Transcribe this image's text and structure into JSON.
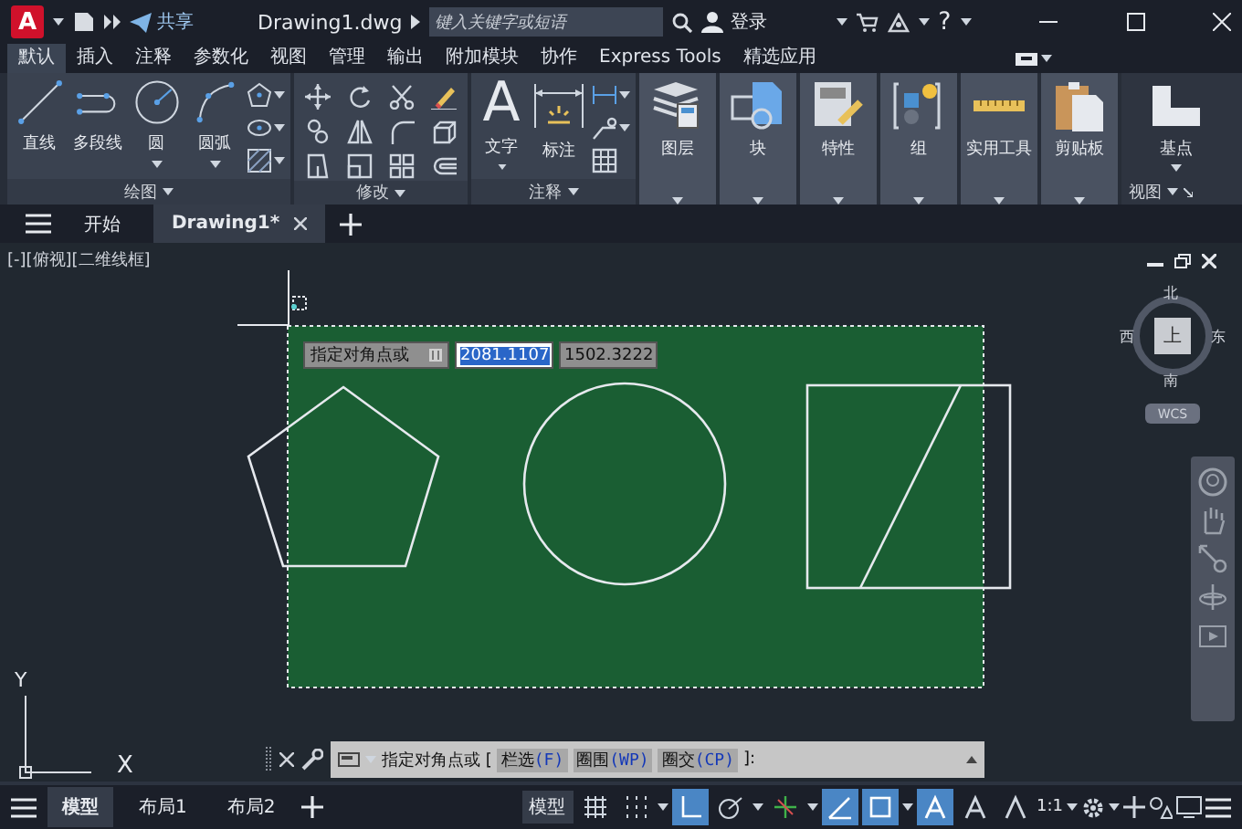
{
  "title_bar": {
    "logo": "A",
    "share": "共享",
    "title": "Drawing1.dwg",
    "search": {
      "placeholder": "键入关键字或短语"
    },
    "sign_in": "登录",
    "help": "?"
  },
  "ribbon_tabs": [
    {
      "label": "默认",
      "selected": true
    },
    {
      "label": "插入",
      "selected": false
    },
    {
      "label": "注释",
      "selected": false
    },
    {
      "label": "参数化",
      "selected": false
    },
    {
      "label": "视图",
      "selected": false
    },
    {
      "label": "管理",
      "selected": false
    },
    {
      "label": "输出",
      "selected": false
    },
    {
      "label": "附加模块",
      "selected": false
    },
    {
      "label": "协作",
      "selected": false
    },
    {
      "label": "Express Tools",
      "selected": false
    },
    {
      "label": "精选应用",
      "selected": false
    }
  ],
  "draw_panel": {
    "title": "绘图",
    "tools": [
      {
        "label": "直线",
        "dropdown": false
      },
      {
        "label": "多段线",
        "dropdown": false
      },
      {
        "label": "圆",
        "dropdown": true
      },
      {
        "label": "圆弧",
        "dropdown": true
      }
    ]
  },
  "modify_panel": {
    "title": "修改"
  },
  "annotation_panel": {
    "title": "注释",
    "text_glyph": "A",
    "tools": [
      {
        "label": "文字"
      },
      {
        "label": "标注"
      }
    ]
  },
  "ribbon_buttons": [
    {
      "label": "图层"
    },
    {
      "label": "块"
    },
    {
      "label": "特性"
    },
    {
      "label": "组"
    },
    {
      "label": "实用工具"
    },
    {
      "label": "剪贴板"
    }
  ],
  "view_panel": {
    "button": "基点",
    "title": "视图"
  },
  "file_tabs": [
    {
      "label": "开始",
      "selected": false
    },
    {
      "label": "Drawing1*",
      "selected": true
    }
  ],
  "viewport_label": "[-][俯视][二维线框]",
  "dynamic_input": {
    "prompt": "指定对角点或",
    "x_value": "2081.1107",
    "y_value": "1502.3222"
  },
  "viewcube": {
    "face": "上",
    "north": "北",
    "south": "南",
    "east": "东",
    "west": "西",
    "ucs_menu": "WCS"
  },
  "ucs_icon": {
    "x": "X",
    "y": "Y"
  },
  "command_line": {
    "prompt": "指定对角点或 [",
    "options": [
      {
        "label": "栏选",
        "key": "(F)"
      },
      {
        "label": "圈围",
        "key": "(WP)"
      },
      {
        "label": "圈交",
        "key": "(CP)"
      }
    ],
    "end": "]:"
  },
  "layout_tabs": [
    {
      "label": "模型",
      "selected": true
    },
    {
      "label": "布局1",
      "selected": false
    },
    {
      "label": "布局2",
      "selected": false
    }
  ],
  "status_bar": {
    "model_button": "模型",
    "scale": "1:1",
    "toggles": [
      {
        "on": false
      },
      {
        "on": false
      },
      {
        "on": true
      },
      {
        "on": false
      },
      {
        "on": false
      },
      {
        "on": true
      },
      {
        "on": true
      },
      {
        "on": true
      },
      {
        "on": false
      },
      {
        "on": false
      }
    ]
  }
}
